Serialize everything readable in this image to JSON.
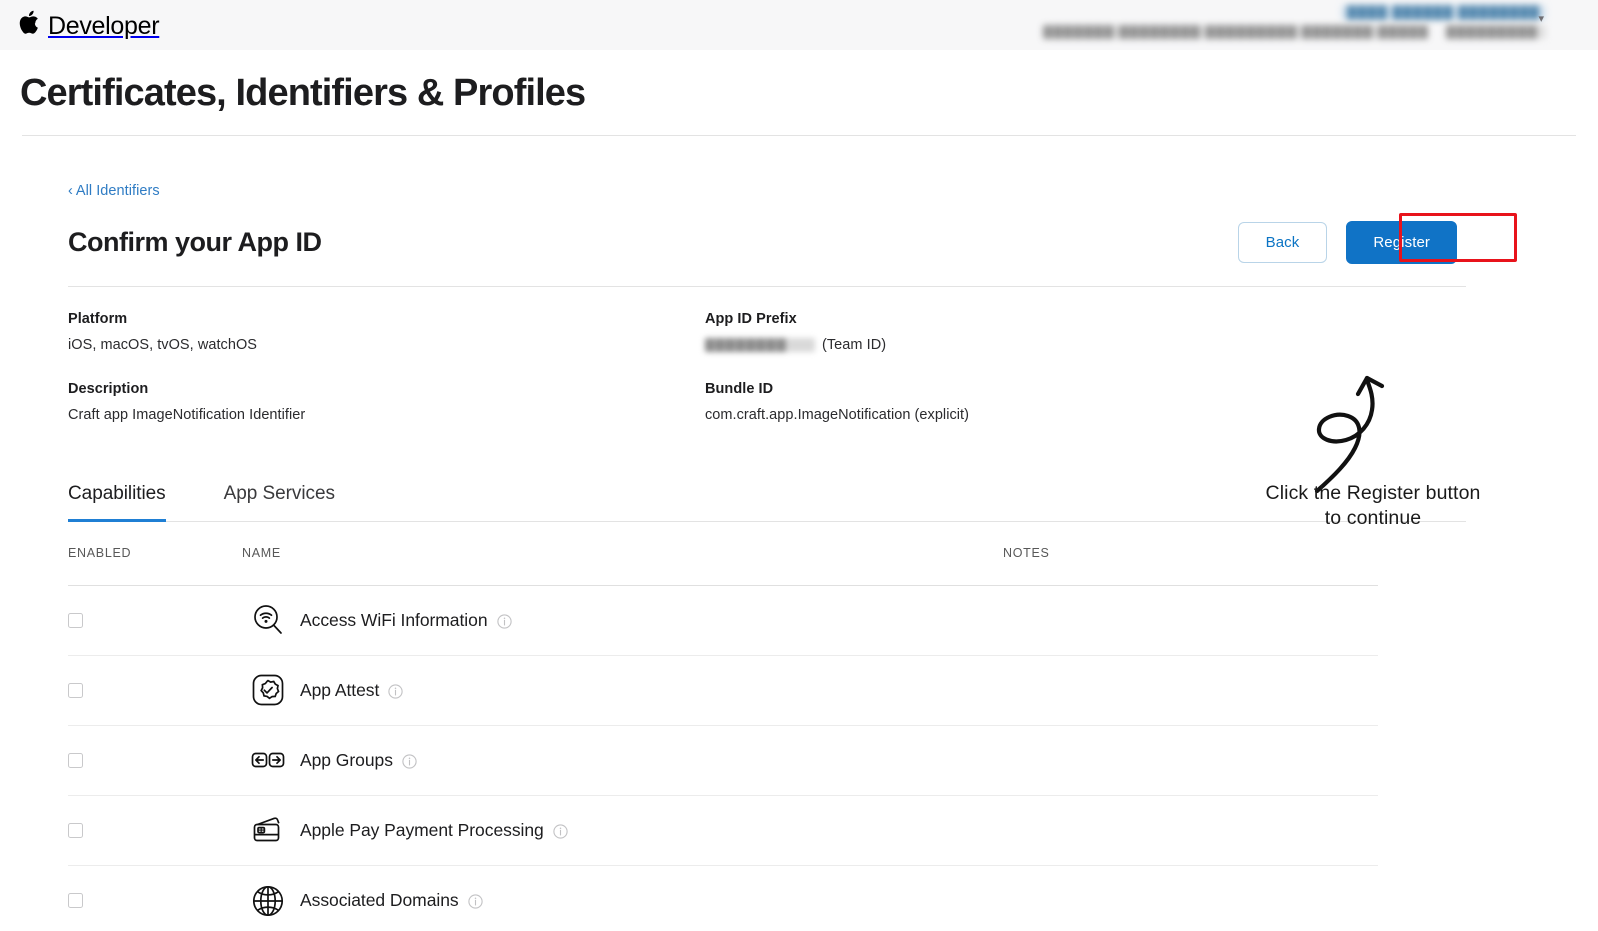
{
  "globalnav": {
    "brand": "Developer",
    "apple_logo_icon": "apple-logo-icon",
    "account_name_redacted": "████ ██████ ████████",
    "org_name_redacted": "███████ ████████ █████████ ███████ ███████",
    "org_id_redacted": "█████████",
    "chevron_icon": "chevron-down-icon"
  },
  "page": {
    "title": "Certificates, Identifiers & Profiles"
  },
  "breadcrumb": {
    "chevron": "‹",
    "label": "All Identifiers"
  },
  "section": {
    "title": "Confirm your App ID",
    "back_label": "Back",
    "register_label": "Register"
  },
  "details": {
    "platform_label": "Platform",
    "platform_value": "iOS, macOS, tvOS, watchOS",
    "appid_prefix_label": "App ID Prefix",
    "appid_prefix_redacted": "████████",
    "appid_prefix_suffix": "(Team ID)",
    "description_label": "Description",
    "description_value": "Craft app ImageNotification Identifier",
    "bundleid_label": "Bundle ID",
    "bundleid_value": "com.craft.app.ImageNotification (explicit)"
  },
  "annotation": {
    "line1": "Click the Register button",
    "line2": "to continue",
    "arrow_icon": "curved-arrow-icon",
    "highlight_color": "#e8131b"
  },
  "tabs": [
    {
      "label": "Capabilities",
      "active": true
    },
    {
      "label": "App Services",
      "active": false
    }
  ],
  "table": {
    "headers": {
      "enabled": "ENABLED",
      "name": "NAME",
      "notes": "NOTES"
    },
    "rows": [
      {
        "name": "Access WiFi Information",
        "icon": "wifi-magnifier-icon",
        "enabled": false,
        "notes": ""
      },
      {
        "name": "App Attest",
        "icon": "badge-check-icon",
        "enabled": false,
        "notes": ""
      },
      {
        "name": "App Groups",
        "icon": "app-groups-arrows-icon",
        "enabled": false,
        "notes": ""
      },
      {
        "name": "Apple Pay Payment Processing",
        "icon": "payment-cards-icon",
        "enabled": false,
        "notes": ""
      },
      {
        "name": "Associated Domains",
        "icon": "globe-icon",
        "enabled": false,
        "notes": ""
      }
    ]
  },
  "colors": {
    "accent_blue": "#1073c6",
    "link_blue": "#2f7cc4",
    "tab_underline": "#1f7fd4",
    "highlight_red": "#e8131b",
    "nav_background": "#f7f7f8"
  }
}
